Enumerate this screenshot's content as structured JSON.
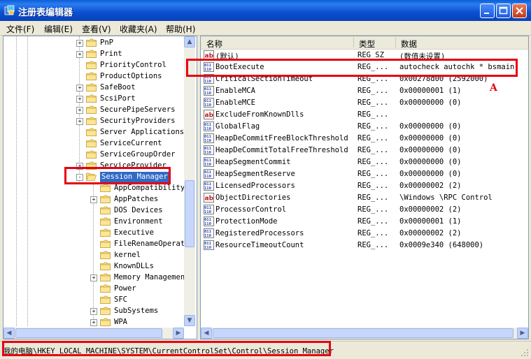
{
  "window": {
    "title": "注册表编辑器"
  },
  "menu": [
    {
      "label": "文件(F)"
    },
    {
      "label": "编辑(E)"
    },
    {
      "label": "查看(V)"
    },
    {
      "label": "收藏夹(A)"
    },
    {
      "label": "帮助(H)"
    }
  ],
  "tree": {
    "items": [
      {
        "label": "PnP",
        "expander": "+"
      },
      {
        "label": "Print",
        "expander": "+"
      },
      {
        "label": "PriorityControl",
        "expander": ""
      },
      {
        "label": "ProductOptions",
        "expander": ""
      },
      {
        "label": "SafeBoot",
        "expander": "+"
      },
      {
        "label": "ScsiPort",
        "expander": "+"
      },
      {
        "label": "SecurePipeServers",
        "expander": "+"
      },
      {
        "label": "SecurityProviders",
        "expander": "+"
      },
      {
        "label": "Server Applications",
        "expander": ""
      },
      {
        "label": "ServiceCurrent",
        "expander": ""
      },
      {
        "label": "ServiceGroupOrder",
        "expander": ""
      },
      {
        "label": "ServiceProvider",
        "expander": "+"
      },
      {
        "label": "Session Manager",
        "expander": "-",
        "selected": true
      },
      {
        "label": "AppCompatibility",
        "expander": "",
        "child": true
      },
      {
        "label": "AppPatches",
        "expander": "+",
        "child": true
      },
      {
        "label": "DOS Devices",
        "expander": "",
        "child": true
      },
      {
        "label": "Environment",
        "expander": "",
        "child": true
      },
      {
        "label": "Executive",
        "expander": "",
        "child": true
      },
      {
        "label": "FileRenameOperati",
        "expander": "",
        "child": true
      },
      {
        "label": "kernel",
        "expander": "",
        "child": true
      },
      {
        "label": "KnownDLLs",
        "expander": "",
        "child": true
      },
      {
        "label": "Memory Management",
        "expander": "+",
        "child": true
      },
      {
        "label": "Power",
        "expander": "",
        "child": true
      },
      {
        "label": "SFC",
        "expander": "",
        "child": true
      },
      {
        "label": "SubSystems",
        "expander": "+",
        "child": true
      },
      {
        "label": "WPA",
        "expander": "+",
        "child": true
      }
    ]
  },
  "columns": {
    "name": "名称",
    "type": "类型",
    "data": "数据"
  },
  "values": [
    {
      "icon": "string-value-icon",
      "name": "(默认)",
      "type": "REG_SZ",
      "data": "(数值未设置)"
    },
    {
      "icon": "binary-value-icon",
      "name": "BootExecute",
      "type": "REG_...",
      "data": "autocheck autochk *  bsmain"
    },
    {
      "icon": "binary-value-icon",
      "name": "CriticalSectionTimeout",
      "type": "REG_...",
      "data": "0x00278d00 (2592000)"
    },
    {
      "icon": "binary-value-icon",
      "name": "EnableMCA",
      "type": "REG_...",
      "data": "0x00000001 (1)"
    },
    {
      "icon": "binary-value-icon",
      "name": "EnableMCE",
      "type": "REG_...",
      "data": "0x00000000 (0)"
    },
    {
      "icon": "string-value-icon",
      "name": "ExcludeFromKnownDlls",
      "type": "REG_...",
      "data": ""
    },
    {
      "icon": "binary-value-icon",
      "name": "GlobalFlag",
      "type": "REG_...",
      "data": "0x00000000 (0)"
    },
    {
      "icon": "binary-value-icon",
      "name": "HeapDeCommitFreeBlockThreshold",
      "type": "REG_...",
      "data": "0x00000000 (0)"
    },
    {
      "icon": "binary-value-icon",
      "name": "HeapDeCommitTotalFreeThreshold",
      "type": "REG_...",
      "data": "0x00000000 (0)"
    },
    {
      "icon": "binary-value-icon",
      "name": "HeapSegmentCommit",
      "type": "REG_...",
      "data": "0x00000000 (0)"
    },
    {
      "icon": "binary-value-icon",
      "name": "HeapSegmentReserve",
      "type": "REG_...",
      "data": "0x00000000 (0)"
    },
    {
      "icon": "binary-value-icon",
      "name": "LicensedProcessors",
      "type": "REG_...",
      "data": "0x00000002 (2)"
    },
    {
      "icon": "string-value-icon",
      "name": "ObjectDirectories",
      "type": "REG_...",
      "data": "\\Windows \\RPC Control"
    },
    {
      "icon": "binary-value-icon",
      "name": "ProcessorControl",
      "type": "REG_...",
      "data": "0x00000002 (2)"
    },
    {
      "icon": "binary-value-icon",
      "name": "ProtectionMode",
      "type": "REG_...",
      "data": "0x00000001 (1)"
    },
    {
      "icon": "binary-value-icon",
      "name": "RegisteredProcessors",
      "type": "REG_...",
      "data": "0x00000002 (2)"
    },
    {
      "icon": "binary-value-icon",
      "name": "ResourceTimeoutCount",
      "type": "REG_...",
      "data": "0x0009e340 (648000)"
    }
  ],
  "annotation": {
    "label": "A"
  },
  "status": {
    "path": "我的电脑\\HKEY_LOCAL_MACHINE\\SYSTEM\\CurrentControlSet\\Control\\Session Manager"
  },
  "colors": {
    "highlight": "#e60012",
    "title_bar": "#0a5fd8",
    "selection": "#316ac5"
  }
}
